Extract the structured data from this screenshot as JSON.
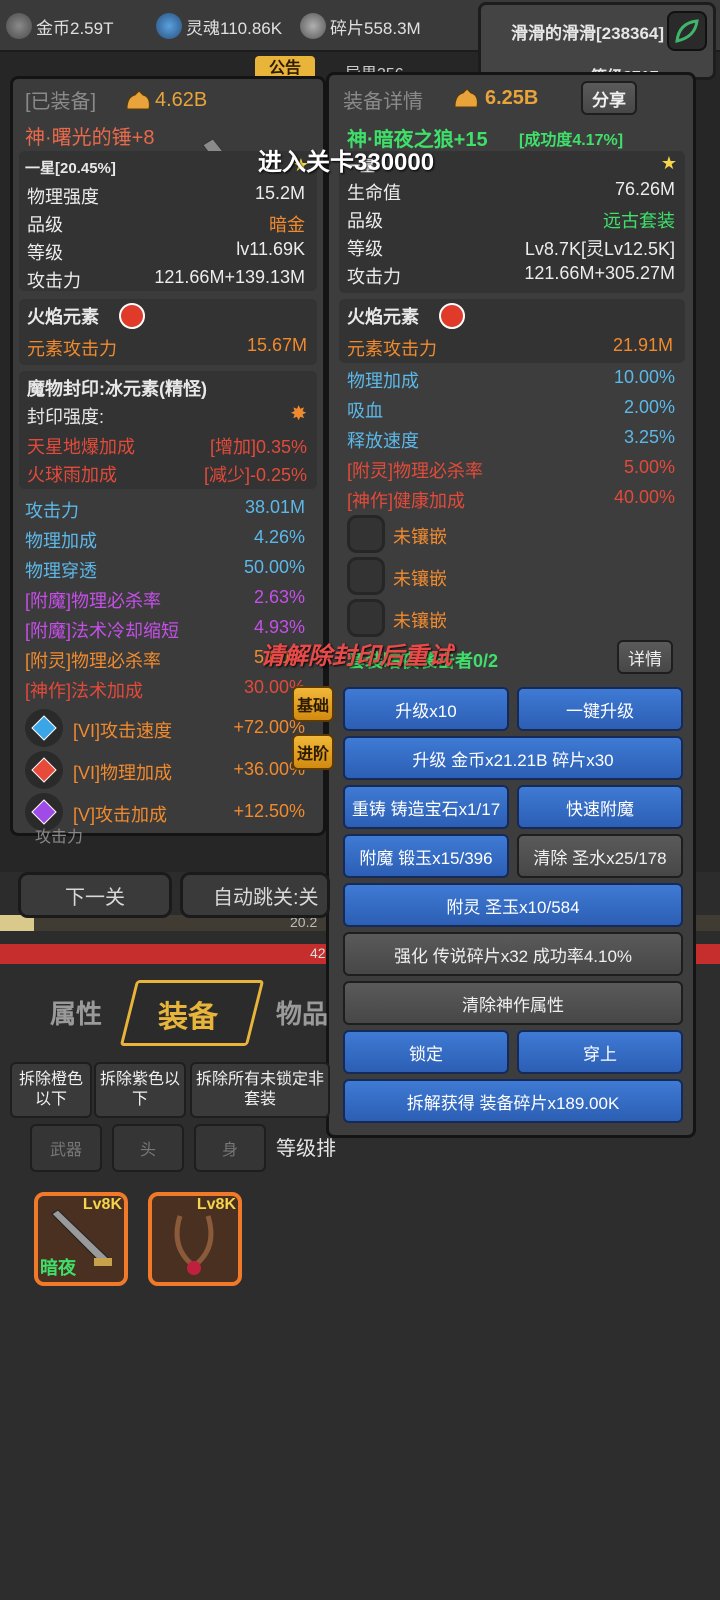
{
  "topbar": {
    "gold": "金币2.59T",
    "soul": "灵魂110.86K",
    "shard": "碎片558.3M",
    "player": "滑滑的滑滑[238364]",
    "level": "等级8717",
    "notice": "公告",
    "realm": "异界356"
  },
  "left": {
    "tag": "[已装备]",
    "power": "4.62B",
    "name": "神·曙光的锤+8",
    "star_line": "一星[20.45%]",
    "stats": [
      {
        "k": "物理强度",
        "v": "15.2M"
      },
      {
        "k": "品级",
        "v": "暗金"
      },
      {
        "k": "等级",
        "v": "lv11.69K"
      },
      {
        "k": "攻击力",
        "v": "121.66M+139.13M"
      }
    ],
    "element": {
      "title": "火焰元素",
      "k": "元素攻击力",
      "v": "15.67M"
    },
    "seal": {
      "title": "魔物封印:冰元素(精怪)",
      "strength": "封印强度:",
      "lines": [
        {
          "k": "天星地爆加成",
          "v": "[增加]0.35%"
        },
        {
          "k": "火球雨加成",
          "v": "[减少]-0.25%"
        }
      ]
    },
    "extras": [
      {
        "k": "攻击力",
        "v": "38.01M"
      },
      {
        "k": "物理加成",
        "v": "4.26%"
      },
      {
        "k": "物理穿透",
        "v": "50.00%"
      },
      {
        "k": "[附魔]物理必杀率",
        "v": "2.63%"
      },
      {
        "k": "[附魔]法术冷却缩短",
        "v": "4.93%"
      },
      {
        "k": "[附灵]物理必杀率",
        "v": "5.00%"
      },
      {
        "k": "[神作]法术加成",
        "v": "30.00%"
      }
    ],
    "gems": [
      {
        "k": "[VI]攻击速度",
        "v": "+72.00%"
      },
      {
        "k": "[VI]物理加成",
        "v": "+36.00%"
      },
      {
        "k": "[V]攻击加成",
        "v": "+12.50%"
      }
    ],
    "bottom_cut": "攻击力"
  },
  "right": {
    "title": "装备详情",
    "power": "6.25B",
    "share": "分享",
    "name": "神·暗夜之狼+15",
    "success": "[成功度4.17%]",
    "star_line": "一星",
    "stats": [
      {
        "k": "生命值",
        "v": "76.26M"
      },
      {
        "k": "品级",
        "v": "远古套装"
      },
      {
        "k": "等级",
        "v": "Lv8.7K[灵Lv12.5K]"
      },
      {
        "k": "攻击力",
        "v": "121.66M+305.27M"
      }
    ],
    "element": {
      "title": "火焰元素",
      "k": "元素攻击力",
      "v": "21.91M"
    },
    "extras": [
      {
        "k": "物理加成",
        "v": "10.00%"
      },
      {
        "k": "吸血",
        "v": "2.00%"
      },
      {
        "k": "释放速度",
        "v": "3.25%"
      },
      {
        "k": "[附灵]物理必杀率",
        "v": "5.00%"
      },
      {
        "k": "[神作]健康加成",
        "v": "40.00%"
      }
    ],
    "sockets": [
      "未镶嵌",
      "未镶嵌",
      "未镶嵌"
    ],
    "set": "套装暗夜袭击者0/2",
    "detail": "详情",
    "buttons": {
      "up10": "升级x10",
      "up_all": "一键升级",
      "up_cost": "升级 金币x21.21B 碎片x30",
      "recast": "重铸 铸造宝石x1/17",
      "quick_enchant": "快速附魔",
      "enchant": "附魔 锻玉x15/396",
      "clear": "清除 圣水x25/178",
      "spirit": "附灵 圣玉x10/584",
      "strengthen": "强化 传说碎片x32 成功率4.10%",
      "clear_god": "清除神作属性",
      "lock": "锁定",
      "equip": "穿上",
      "dismantle": "拆解获得 装备碎片x189.00K"
    },
    "tabs": {
      "basic": "基础",
      "advanced": "进阶"
    }
  },
  "float": {
    "enter": "进入关卡330000",
    "seal_msg": "请解除封印后重试"
  },
  "mid": {
    "next": "下一关",
    "auto": "自动跳关:关",
    "hp1": "20.2",
    "hp2": "42"
  },
  "bottom": {
    "tabs": [
      "属性",
      "装备",
      "物品"
    ],
    "dismantle": [
      "拆除橙色以下",
      "拆除紫色以下",
      "拆除所有未锁定非套装"
    ],
    "filters": [
      "武器",
      "头",
      "身"
    ],
    "sort": "等级排",
    "items": [
      {
        "lv": "Lv8K",
        "tag": "暗夜"
      },
      {
        "lv": "Lv8K",
        "tag": ""
      }
    ]
  }
}
